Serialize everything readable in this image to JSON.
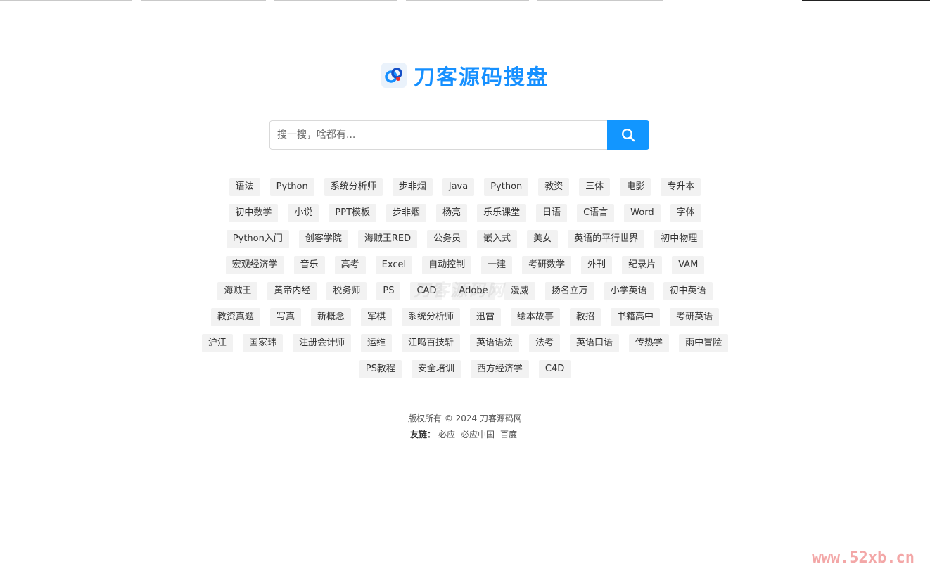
{
  "brand": {
    "name": "刀客源码搜盘",
    "color": "#1690ff"
  },
  "search": {
    "placeholder": "搜一搜，啥都有...",
    "value": "",
    "button_icon": "search-icon",
    "button_color": "#1296ff"
  },
  "tags": [
    [
      "语法",
      "Python",
      "系统分析师",
      "步非烟",
      "Java",
      "Python",
      "教资",
      "三体",
      "电影",
      "专升本"
    ],
    [
      "初中数学",
      "小说",
      "PPT模板",
      "步非烟",
      "杨亮",
      "乐乐课堂",
      "日语",
      "C语言",
      "Word",
      "字体"
    ],
    [
      "Python入门",
      "创客学院",
      "海贼王RED",
      "公务员",
      "嵌入式",
      "美女",
      "英语的平行世界",
      "初中物理"
    ],
    [
      "宏观经济学",
      "音乐",
      "高考",
      "Excel",
      "自动控制",
      "一建",
      "考研数学",
      "外刊",
      "纪录片",
      "VAM"
    ],
    [
      "海贼王",
      "黄帝内经",
      "税务师",
      "PS",
      "CAD",
      "Adobe",
      "漫威",
      "扬名立万",
      "小学英语",
      "初中英语"
    ],
    [
      "教资真题",
      "写真",
      "新概念",
      "军棋",
      "系统分析师",
      "迅雷",
      "绘本故事",
      "教招",
      "书籍高中",
      "考研英语"
    ],
    [
      "沪江",
      "国家玮",
      "注册会计师",
      "运维",
      "江鸣百技斩",
      "英语语法",
      "法考",
      "英语口语",
      "传热学",
      "雨中冒险"
    ],
    [
      "PS教程",
      "安全培训",
      "西方经济学",
      "C4D"
    ]
  ],
  "footer": {
    "copyright": "版权所有 © 2024 刀客源码网",
    "links_label": "友链：",
    "links": [
      "必应",
      "必应中国",
      "百度"
    ]
  },
  "watermark": "刀客源码网",
  "corner_mark": "www.52xb.cn"
}
